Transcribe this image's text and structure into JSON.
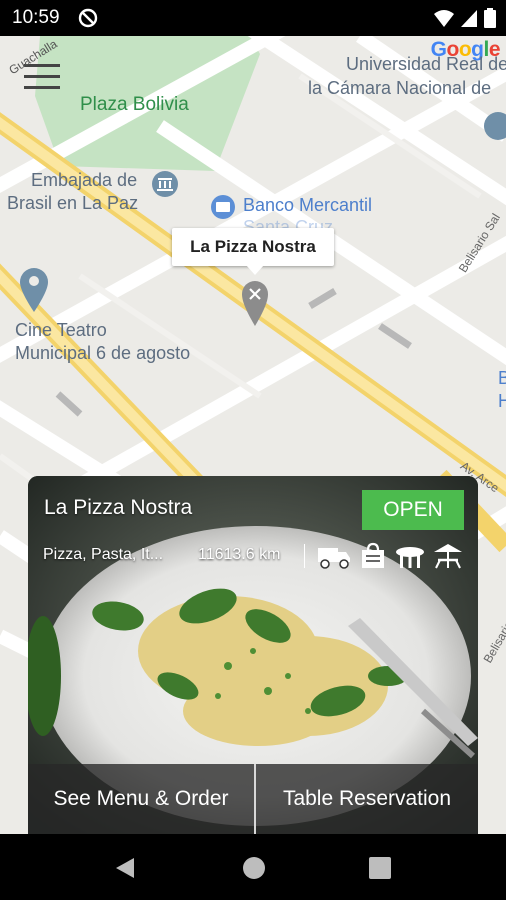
{
  "status_bar": {
    "time": "10:59"
  },
  "map": {
    "google_logo": [
      {
        "ch": "G",
        "color": "#4285F4"
      },
      {
        "ch": "o",
        "color": "#EA4335"
      },
      {
        "ch": "o",
        "color": "#FBBC05"
      },
      {
        "ch": "g",
        "color": "#4285F4"
      },
      {
        "ch": "l",
        "color": "#34A853"
      },
      {
        "ch": "e",
        "color": "#EA4335"
      }
    ],
    "labels": {
      "plaza": "Plaza Bolivia",
      "universidad_1": "Universidad Real de",
      "universidad_2": "la Cámara Nacional de",
      "embajada_1": "Embajada de",
      "embajada_2": "Brasil en La Paz",
      "banco_1": "Banco Mercantil",
      "banco_2": "Santa Cruz",
      "cine_1": "Cine Teatro",
      "cine_2": "Municipal 6 de agosto",
      "street_guachalla": "Guachalla",
      "street_belisario": "Belisario Sal",
      "street_arce": "Av. Arce",
      "street_salinas": "Belisario Sal",
      "edge_b": "B",
      "edge_h": "H"
    },
    "marker_callout": "La Pizza Nostra"
  },
  "restaurant_card": {
    "name": "La Pizza Nostra",
    "status": "OPEN",
    "cuisine": "Pizza, Pasta, It...",
    "distance": "11613.6 km",
    "services": [
      "delivery-truck-icon",
      "takeaway-bag-icon",
      "dine-in-table-icon",
      "outdoor-table-icon"
    ],
    "buttons": {
      "menu": "See Menu & Order",
      "reservation": "Table Reservation"
    }
  },
  "colors": {
    "open_badge": "#4cbb4e",
    "road_major": "#f6d96b",
    "park": "#c8e6c9",
    "poi_blue": "#5c8fd6"
  }
}
